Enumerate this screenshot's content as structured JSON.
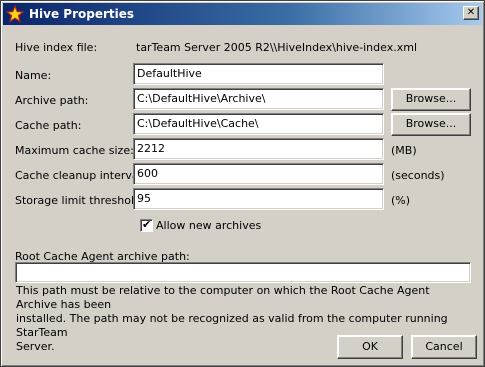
{
  "window": {
    "title": "Hive Properties",
    "close_symbol": "✕"
  },
  "hive_index": {
    "label": "Hive index file:",
    "value": "tarTeam Server 2005 R2\\\\HiveIndex\\hive-index.xml"
  },
  "fields": {
    "name": {
      "label": "Name:",
      "value": "DefaultHive"
    },
    "archive_path": {
      "label": "Archive path:",
      "value": "C:\\DefaultHive\\Archive\\"
    },
    "cache_path": {
      "label": "Cache path:",
      "value": "C:\\DefaultHive\\Cache\\"
    },
    "max_cache_size": {
      "label": "Maximum cache size:",
      "value": "2212",
      "unit": "(MB)"
    },
    "cache_cleanup_interval": {
      "label": "Cache cleanup interval:",
      "value": "600",
      "unit": "(seconds)"
    },
    "storage_limit_threshold": {
      "label": "Storage limit threshold:",
      "value": "95",
      "unit": "(%)"
    }
  },
  "browse_label": "Browse...",
  "allow_new_archives": {
    "label": "Allow new archives",
    "checked": true,
    "check_glyph": "✔"
  },
  "root_cache_agent": {
    "label": "Root Cache Agent archive path:",
    "value": "",
    "note_line1": "This path must be relative to the computer on which the Root Cache Agent Archive has been",
    "note_line2": "installed.  The path may not be recognized as valid from the computer running StarTeam",
    "note_line3": "Server."
  },
  "buttons": {
    "ok": "OK",
    "cancel": "Cancel"
  }
}
